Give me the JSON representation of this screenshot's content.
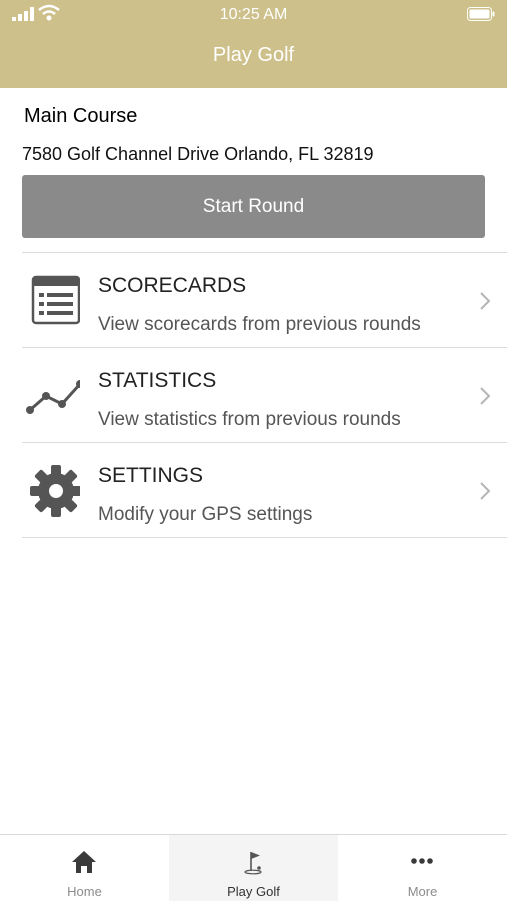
{
  "status_bar": {
    "time": "10:25 AM"
  },
  "header": {
    "title": "Play Golf"
  },
  "course": {
    "name": "Main Course",
    "address": "7580 Golf Channel Drive Orlando, FL 32819",
    "start_button": "Start Round"
  },
  "menu": [
    {
      "title": "SCORECARDS",
      "subtitle": "View scorecards from previous rounds",
      "icon": "scorecard-icon"
    },
    {
      "title": "STATISTICS",
      "subtitle": "View statistics from previous rounds",
      "icon": "statistics-icon"
    },
    {
      "title": "SETTINGS",
      "subtitle": "Modify your GPS settings",
      "icon": "gear-icon"
    }
  ],
  "tabs": [
    {
      "label": "Home",
      "icon": "home-icon"
    },
    {
      "label": "Play Golf",
      "icon": "golf-flag-icon"
    },
    {
      "label": "More",
      "icon": "more-icon"
    }
  ],
  "colors": {
    "header": "#cdc08a",
    "button": "#8a8a8a"
  }
}
